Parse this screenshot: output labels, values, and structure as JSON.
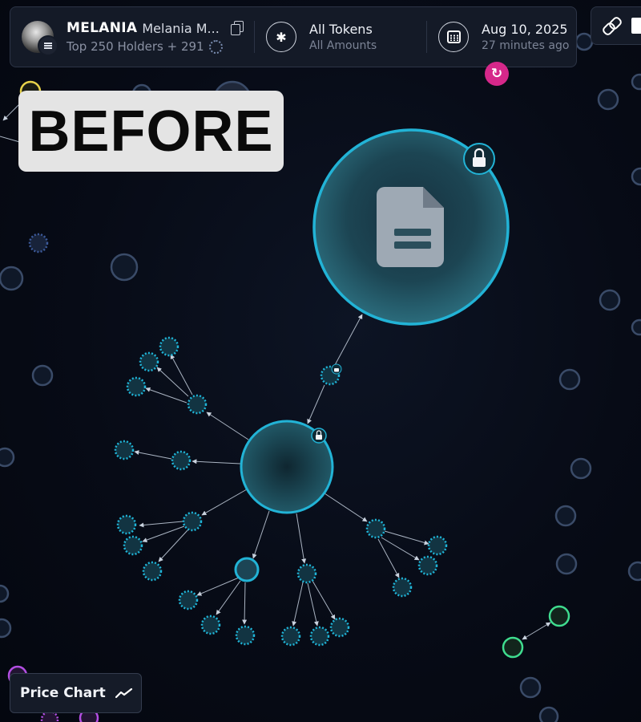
{
  "header": {
    "token_ticker": "MELANIA",
    "token_name": "Melania M...",
    "holders_label": "Top 250 Holders + 291",
    "filter_title": "All Tokens",
    "filter_subtitle": "All Amounts",
    "filter_icon_glyph": "✱",
    "date": "Aug 10, 2025",
    "relative_time": "27 minutes ago"
  },
  "icons": {
    "avatar": "token-avatar",
    "chain": "solana-icon",
    "copy": "copy-icon",
    "loading": "spinner-icon",
    "filter": "asterisk-icon",
    "calendar": "calendar-icon",
    "link": "link-icon",
    "refresh": "refresh-icon",
    "chart": "trend-icon",
    "lock": "lock-icon",
    "document": "document-icon"
  },
  "overlay_label": "BEFORE",
  "price_chart_button": "Price Chart",
  "refresh_glyph": "↻",
  "colors": {
    "background": "#070b16",
    "cluster_node": "#1fb5d8",
    "refresh_button": "#d6288a",
    "green_node": "#3fdc8f",
    "yellow_node": "#e7d24a",
    "purple_node": "#b34ee3"
  }
}
